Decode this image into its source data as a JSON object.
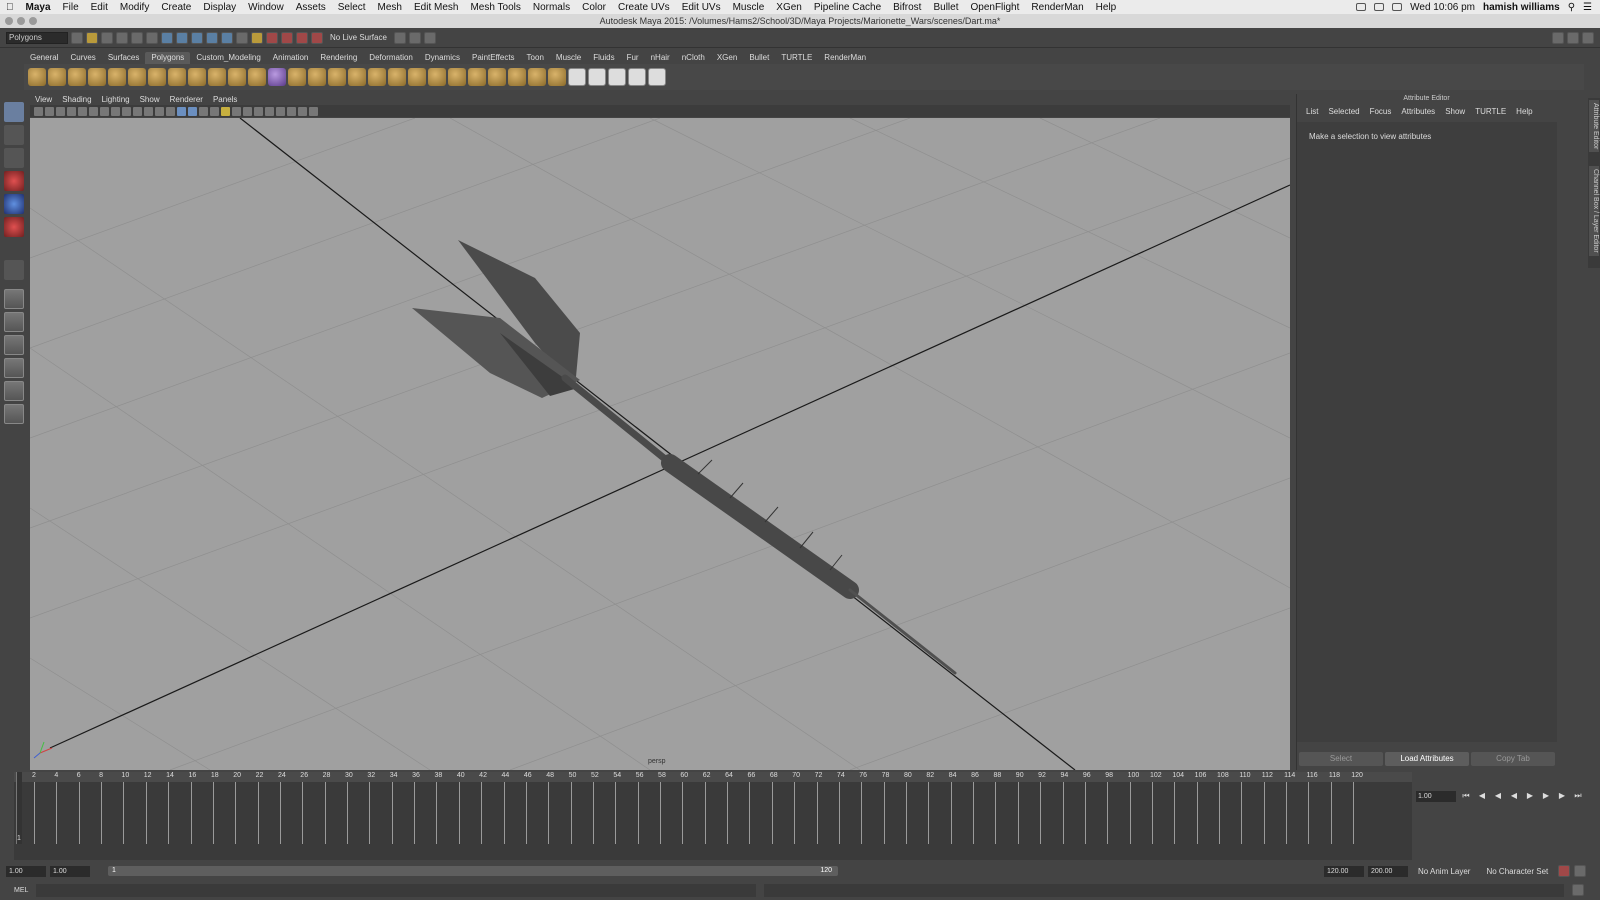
{
  "menubar": {
    "app": "Maya",
    "items": [
      "File",
      "Edit",
      "Modify",
      "Create",
      "Display",
      "Window",
      "Assets",
      "Select",
      "Mesh",
      "Edit Mesh",
      "Mesh Tools",
      "Normals",
      "Color",
      "Create UVs",
      "Edit UVs",
      "Muscle",
      "XGen",
      "Pipeline Cache",
      "Bifrost",
      "Bullet",
      "OpenFlight",
      "RenderMan",
      "Help"
    ],
    "clock": "Wed 10:06 pm",
    "user": "hamish williams"
  },
  "window": {
    "title": "Autodesk Maya 2015: /Volumes/Hams2/School/3D/Maya Projects/Marionette_Wars/scenes/Dart.ma*"
  },
  "statusline": {
    "mode": "Polygons",
    "live_surface": "No Live Surface"
  },
  "shelf": {
    "tabs": [
      "General",
      "Curves",
      "Surfaces",
      "Polygons",
      "Custom_Modeling",
      "Animation",
      "Rendering",
      "Deformation",
      "Dynamics",
      "PaintEffects",
      "Toon",
      "Muscle",
      "Fluids",
      "Fur",
      "nHair",
      "nCloth",
      "XGen",
      "Bullet",
      "TURTLE",
      "RenderMan"
    ],
    "active": "Polygons"
  },
  "viewport": {
    "menu": [
      "View",
      "Shading",
      "Lighting",
      "Show",
      "Renderer",
      "Panels"
    ],
    "camera_label": "persp"
  },
  "attribute_editor": {
    "title": "Attribute Editor",
    "menu": [
      "List",
      "Selected",
      "Focus",
      "Attributes",
      "Show",
      "TURTLE",
      "Help"
    ],
    "message": "Make a selection to view attributes",
    "buttons": {
      "select": "Select",
      "load": "Load Attributes",
      "copy": "Copy Tab"
    }
  },
  "side_tabs": {
    "attr": "Attribute Editor",
    "channel": "Channel Box / Layer Editor"
  },
  "timeline": {
    "ticks": [
      "2",
      "4",
      "6",
      "8",
      "10",
      "12",
      "14",
      "16",
      "18",
      "20",
      "22",
      "24",
      "26",
      "28",
      "30",
      "32",
      "34",
      "36",
      "38",
      "40",
      "42",
      "44",
      "46",
      "48",
      "50",
      "52",
      "54",
      "56",
      "58",
      "60",
      "62",
      "64",
      "66",
      "68",
      "70",
      "72",
      "74",
      "76",
      "78",
      "80",
      "82",
      "84",
      "86",
      "88",
      "90",
      "92",
      "94",
      "96",
      "98",
      "100",
      "102",
      "104",
      "106",
      "108",
      "110",
      "112",
      "114",
      "116",
      "118",
      "120"
    ],
    "current_frame": "1",
    "current_time": "1.00"
  },
  "range": {
    "start": "1.00",
    "playback_start": "1.00",
    "slider_start": "1",
    "slider_end": "120",
    "playback_end": "120.00",
    "end": "200.00",
    "anim_layer": "No Anim Layer",
    "character_set": "No Character Set"
  },
  "command_line": {
    "label": "MEL"
  }
}
